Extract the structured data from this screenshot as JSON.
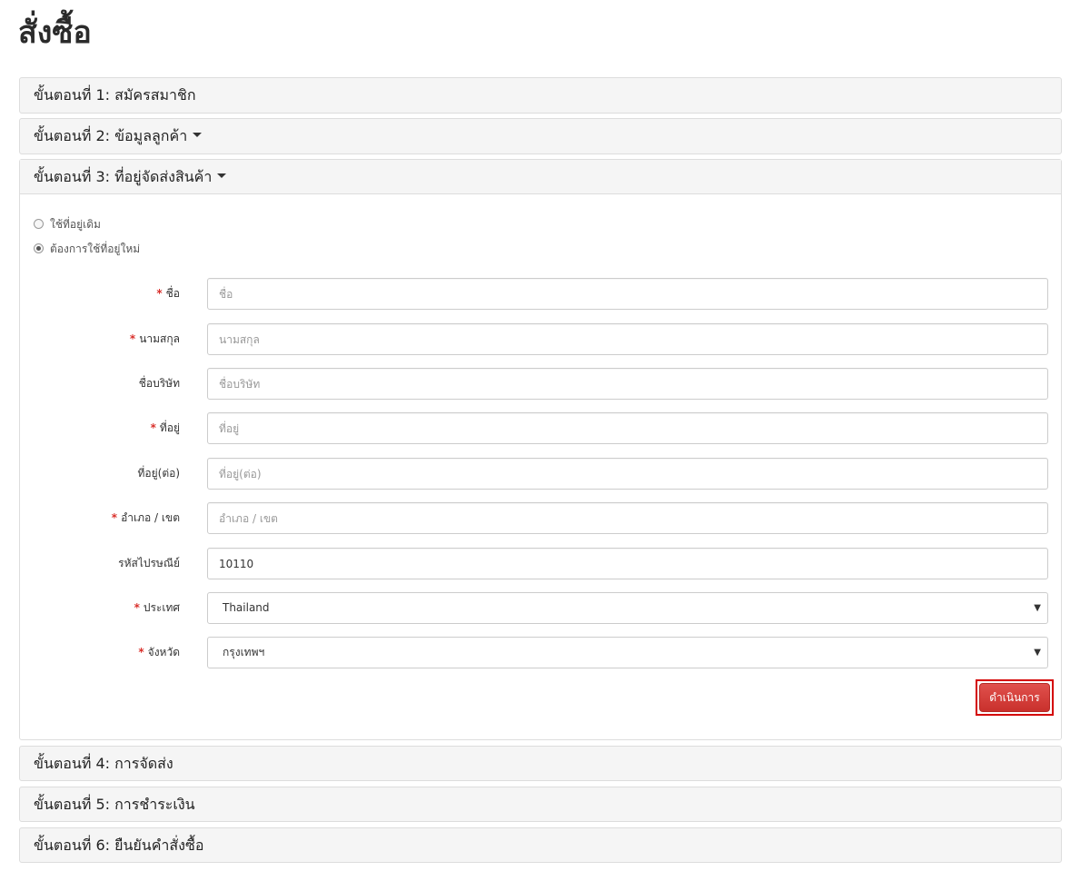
{
  "page": {
    "title": "สั่งซื้อ"
  },
  "steps": [
    {
      "label": "ขั้นตอนที่ 1: สมัครสมาชิก"
    },
    {
      "label": "ขั้นตอนที่ 2: ข้อมูลลูกค้า"
    },
    {
      "label": "ขั้นตอนที่ 3: ที่อยู่จัดส่งสินค้า"
    },
    {
      "label": "ขั้นตอนที่ 4: การจัดส่ง"
    },
    {
      "label": "ขั้นตอนที่ 5: การชำระเงิน"
    },
    {
      "label": "ขั้นตอนที่ 6: ยืนยันคำสั่งซื้อ"
    }
  ],
  "address_options": [
    {
      "label": "ใช้ที่อยู่เดิม",
      "selected": false
    },
    {
      "label": "ต้องการใช้ที่อยู่ใหม่",
      "selected": true
    }
  ],
  "form": {
    "firstname": {
      "label": "ชื่อ",
      "placeholder": "ชื่อ",
      "value": "",
      "required": true
    },
    "lastname": {
      "label": "นามสกุล",
      "placeholder": "นามสกุล",
      "value": "",
      "required": true
    },
    "company": {
      "label": "ชื่อบริษัท",
      "placeholder": "ชื่อบริษัท",
      "value": "",
      "required": false
    },
    "address1": {
      "label": "ที่อยู่",
      "placeholder": "ที่อยู่",
      "value": "",
      "required": true
    },
    "address2": {
      "label": "ที่อยู่(ต่อ)",
      "placeholder": "ที่อยู่(ต่อ)",
      "value": "",
      "required": false
    },
    "city": {
      "label": "อำเภอ / เขต",
      "placeholder": "อำเภอ / เขต",
      "value": "",
      "required": true
    },
    "postcode": {
      "label": "รหัสไปรษณีย์",
      "placeholder": "",
      "value": "10110",
      "required": false
    },
    "country": {
      "label": "ประเทศ",
      "selected": "Thailand",
      "required": true
    },
    "zone": {
      "label": "จังหวัด",
      "selected": "กรุงเทพฯ",
      "required": true
    }
  },
  "required_mark": "*",
  "proceed_label": "ดำเนินการ",
  "colors": {
    "required": "#d9302b",
    "button": "#d9534f",
    "highlight_box": "#d40000"
  }
}
